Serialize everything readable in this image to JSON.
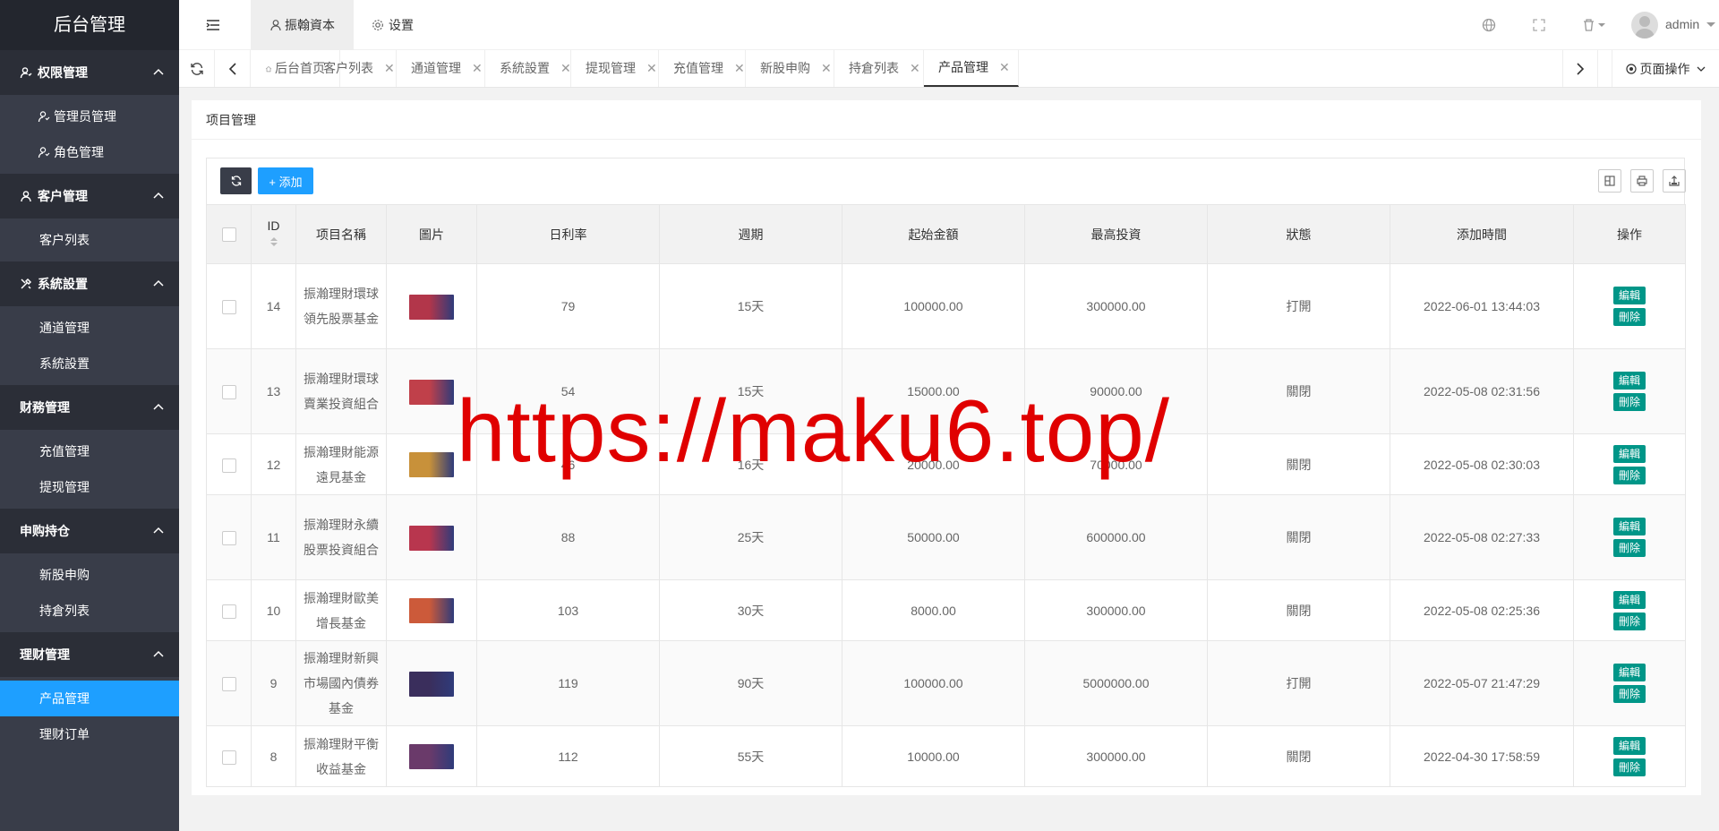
{
  "sidebar": {
    "logo": "后台管理",
    "groups": [
      {
        "title": "权限管理",
        "items": [
          {
            "label": "管理员管理"
          },
          {
            "label": "角色管理"
          }
        ]
      },
      {
        "title": "客户管理",
        "items": [
          {
            "label": "客户列表"
          }
        ]
      },
      {
        "title": "系統設置",
        "items": [
          {
            "label": "通道管理"
          },
          {
            "label": "系統設置"
          }
        ]
      },
      {
        "title": "财務管理",
        "items": [
          {
            "label": "充值管理"
          },
          {
            "label": "提现管理"
          }
        ]
      },
      {
        "title": "申购持仓",
        "items": [
          {
            "label": "新股申购"
          },
          {
            "label": "持倉列表"
          }
        ]
      },
      {
        "title": "理财管理",
        "items": [
          {
            "label": "产品管理"
          },
          {
            "label": "理财订单"
          }
        ]
      }
    ],
    "active_item": "产品管理"
  },
  "topbar": {
    "tabs": [
      {
        "label": "振翰資本"
      },
      {
        "label": "设置"
      }
    ],
    "user": "admin"
  },
  "tabstrip": {
    "tabs": [
      {
        "label": "后台首页"
      },
      {
        "label": "客户列表"
      },
      {
        "label": "通道管理"
      },
      {
        "label": "系統設置"
      },
      {
        "label": "提现管理"
      },
      {
        "label": "充值管理"
      },
      {
        "label": "新股申购"
      },
      {
        "label": "持倉列表"
      },
      {
        "label": "产品管理"
      }
    ],
    "page_ops": "页面操作"
  },
  "content": {
    "title": "项目管理",
    "add_label": "+ 添加",
    "columns": [
      "ID",
      "项目名稱",
      "圖片",
      "日利率",
      "週期",
      "起始金額",
      "最高投資",
      "狀態",
      "添加時間",
      "操作"
    ],
    "edit_label": "編輯",
    "delete_label": "刪除",
    "rows": [
      {
        "id": "14",
        "name": "振瀚理財環球領先股票基金",
        "rate": "79",
        "period": "15天",
        "min": "100000.00",
        "max": "300000.00",
        "status": "打開",
        "time": "2022-06-01 13:44:03",
        "thumb_color": "#b2364a"
      },
      {
        "id": "13",
        "name": "振瀚理財環球賣業投資組合",
        "rate": "54",
        "period": "15天",
        "min": "15000.00",
        "max": "90000.00",
        "status": "關閉",
        "time": "2022-05-08 02:31:56",
        "thumb_color": "#c0404a"
      },
      {
        "id": "12",
        "name": "振瀚理財能源遠見基金",
        "rate": "46",
        "period": "16天",
        "min": "20000.00",
        "max": "70000.00",
        "status": "關閉",
        "time": "2022-05-08 02:30:03",
        "thumb_color": "#c8913a"
      },
      {
        "id": "11",
        "name": "振瀚理財永續股票投資組合",
        "rate": "88",
        "period": "25天",
        "min": "50000.00",
        "max": "600000.00",
        "status": "關閉",
        "time": "2022-05-08 02:27:33",
        "thumb_color": "#b8364e"
      },
      {
        "id": "10",
        "name": "振瀚理財歐美增長基金",
        "rate": "103",
        "period": "30天",
        "min": "8000.00",
        "max": "300000.00",
        "status": "關閉",
        "time": "2022-05-08 02:25:36",
        "thumb_color": "#cc5a3a"
      },
      {
        "id": "9",
        "name": "振瀚理財新興市場國內債券基金",
        "rate": "119",
        "period": "90天",
        "min": "100000.00",
        "max": "5000000.00",
        "status": "打開",
        "time": "2022-05-07 21:47:29",
        "thumb_color": "#3a2e5c"
      },
      {
        "id": "8",
        "name": "振瀚理財平衡收益基金",
        "rate": "112",
        "period": "55天",
        "min": "10000.00",
        "max": "300000.00",
        "status": "關閉",
        "time": "2022-04-30 17:58:59",
        "thumb_color": "#6a3a6a"
      }
    ]
  },
  "watermark": "https://maku6.top/",
  "colors": {
    "sidebar": "#393d49",
    "sidebar_dark": "#23262e",
    "accent": "#1e9fff",
    "op_button": "#009688"
  }
}
